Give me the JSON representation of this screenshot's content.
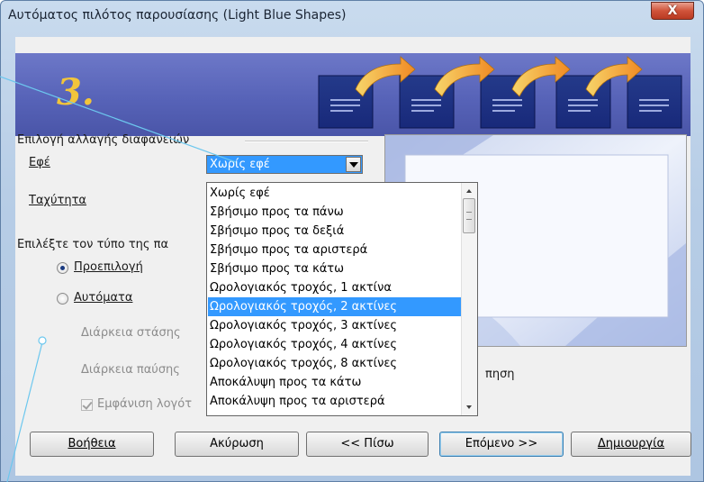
{
  "window": {
    "title": "Αυτόματος πιλότος παρουσίασης (Light Blue Shapes)",
    "close_label": "X"
  },
  "banner": {
    "step": "3."
  },
  "transition_group": {
    "heading": "Επιλογή αλλαγής διαφανειών",
    "effect_label": "Εφέ",
    "speed_label": "Ταχύτητα",
    "effect_selected": "Χωρίς εφέ",
    "dropdown_items": [
      "Χωρίς εφέ",
      "Σβήσιμο προς τα πάνω",
      "Σβήσιμο προς τα δεξιά",
      "Σβήσιμο προς τα αριστερά",
      "Σβήσιμο προς τα κάτω",
      "Ωρολογιακός τροχός, 1 ακτίνα",
      "Ωρολογιακός τροχός, 2 ακτίνες",
      "Ωρολογιακός τροχός, 3 ακτίνες",
      "Ωρολογιακός τροχός, 4 ακτίνες",
      "Ωρολογιακός τροχός, 8 ακτίνες",
      "Αποκάλυψη προς τα κάτω",
      "Αποκάλυψη προς τα αριστερά"
    ],
    "highlighted_item": "Ωρολογιακός τροχός, 2 ακτίνες"
  },
  "presentation_group": {
    "heading": "Επιλέξτε τον τύπο της πα",
    "default_label": "Προεπιλογή",
    "auto_label": "Αυτόματα",
    "duration_stop": "Διάρκεια στάσης",
    "duration_pause": "Διάρκεια παύσης",
    "show_logo": "Εμφάνιση λογότ",
    "preview_label_tail": "πηση"
  },
  "buttons": {
    "help": "Βοήθεια",
    "cancel": "Ακύρωση",
    "back": "<< Πίσω",
    "next": "Επόμενο >>",
    "create": "Δημιουργία"
  },
  "colors": {
    "selection": "#3399ff",
    "banner": "#5763b8",
    "arrow": "#f2b233"
  }
}
